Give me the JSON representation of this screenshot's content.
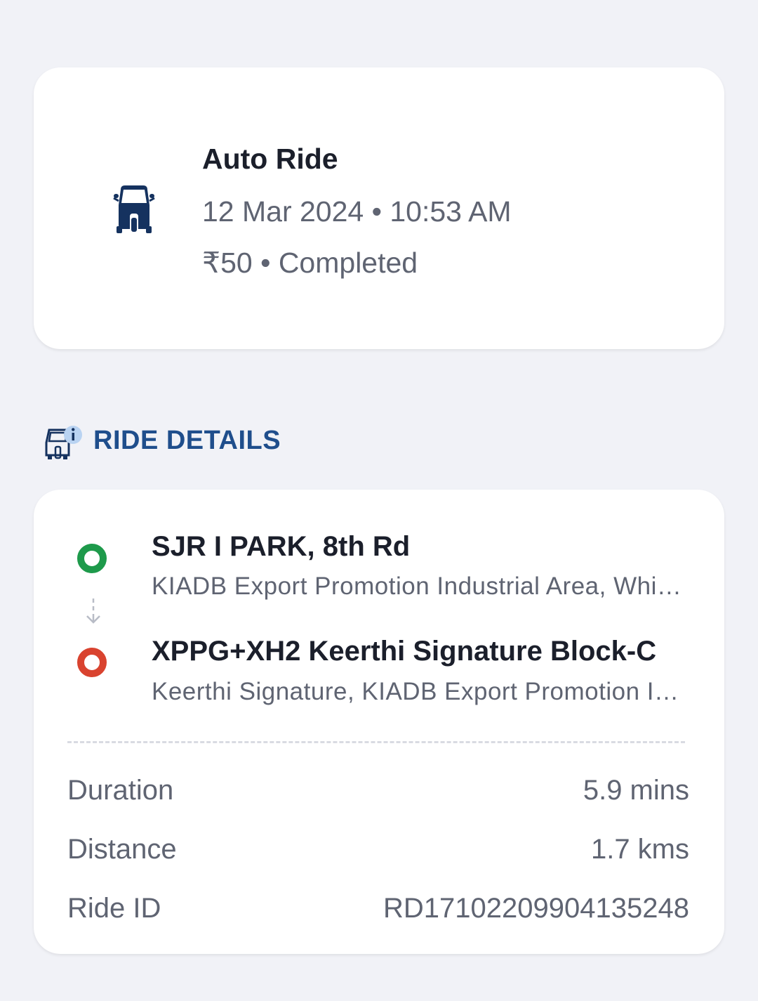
{
  "summary": {
    "icon": "auto-rickshaw-icon",
    "title": "Auto Ride",
    "datetime": "12 Mar 2024 • 10:53 AM",
    "fare_status": "₹50 • Completed"
  },
  "section": {
    "icon": "ride-info-icon",
    "title": "RIDE DETAILS"
  },
  "route": {
    "pickup": {
      "title": "SJR I PARK, 8th Rd",
      "subtitle": "KIADB Export Promotion Industrial Area, Whitefield, Bengaluru",
      "color": "#1e9a4b"
    },
    "drop": {
      "title": "XPPG+XH2 Keerthi Signature Block-C",
      "subtitle": "Keerthi Signature, KIADB Export Promotion Industrial Area",
      "color": "#d9432f"
    }
  },
  "details": {
    "duration": {
      "label": "Duration",
      "value": "5.9 mins"
    },
    "distance": {
      "label": "Distance",
      "value": "1.7 kms"
    },
    "ride_id": {
      "label": "Ride ID",
      "value": "RD17102209904135248"
    }
  },
  "colors": {
    "accent": "#1f4e8c",
    "icon_navy": "#15325f",
    "background": "#f1f2f7"
  }
}
